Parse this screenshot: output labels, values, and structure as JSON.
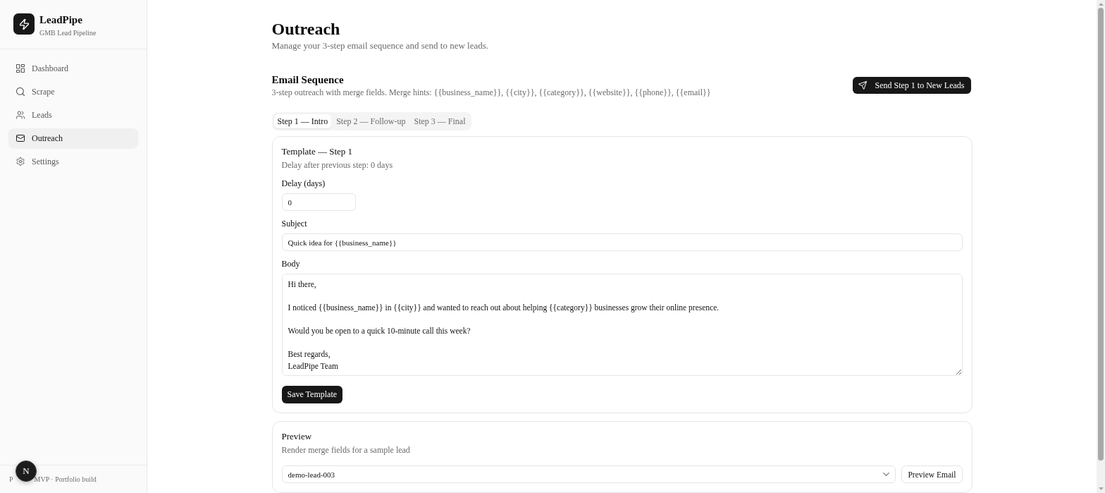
{
  "sidebar": {
    "brand": {
      "name": "LeadPipe",
      "tagline": "GMB Lead Pipeline"
    },
    "nav": [
      {
        "label": "Dashboard",
        "selected": false
      },
      {
        "label": "Scrape",
        "selected": false
      },
      {
        "label": "Leads",
        "selected": false
      },
      {
        "label": "Outreach",
        "selected": true
      },
      {
        "label": "Settings",
        "selected": false
      }
    ],
    "footer": {
      "text_start": "P",
      "text_end": "MVP · Portfolio build"
    }
  },
  "dev_badge": {
    "label": "N"
  },
  "page": {
    "title": "Outreach",
    "subtitle": "Manage your 3-step email sequence and send to new leads."
  },
  "sequence": {
    "title": "Email Sequence",
    "hint": "3-step outreach with merge fields. Merge hints: {{business_name}}, {{city}}, {{category}}, {{website}}, {{phone}}, {{email}}",
    "send_button": "Send Step 1 to New Leads",
    "tabs": [
      {
        "label": "Step 1 — Intro",
        "selected": true
      },
      {
        "label": "Step 2 — Follow-up",
        "selected": false
      },
      {
        "label": "Step 3 — Final",
        "selected": false
      }
    ]
  },
  "template": {
    "title": "Template — Step 1",
    "note": "Delay after previous step: 0 days",
    "fields": [
      {
        "kind": "number",
        "label": "Delay (days)",
        "value": "0"
      },
      {
        "kind": "text",
        "label": "Subject",
        "value": "Quick idea for {{business_name}}"
      },
      {
        "kind": "textarea",
        "label": "Body",
        "value": "Hi there,\n\nI noticed {{business_name}} in {{city}} and wanted to reach out about helping {{category}} businesses grow their online presence.\n\nWould you be open to a quick 10-minute call this week?\n\nBest regards,\nLeadPipe Team"
      }
    ],
    "save_button": "Save Template"
  },
  "preview": {
    "title": "Preview",
    "description": "Render merge fields for a sample lead",
    "select_value": "demo-lead-003",
    "button": "Preview Email"
  }
}
